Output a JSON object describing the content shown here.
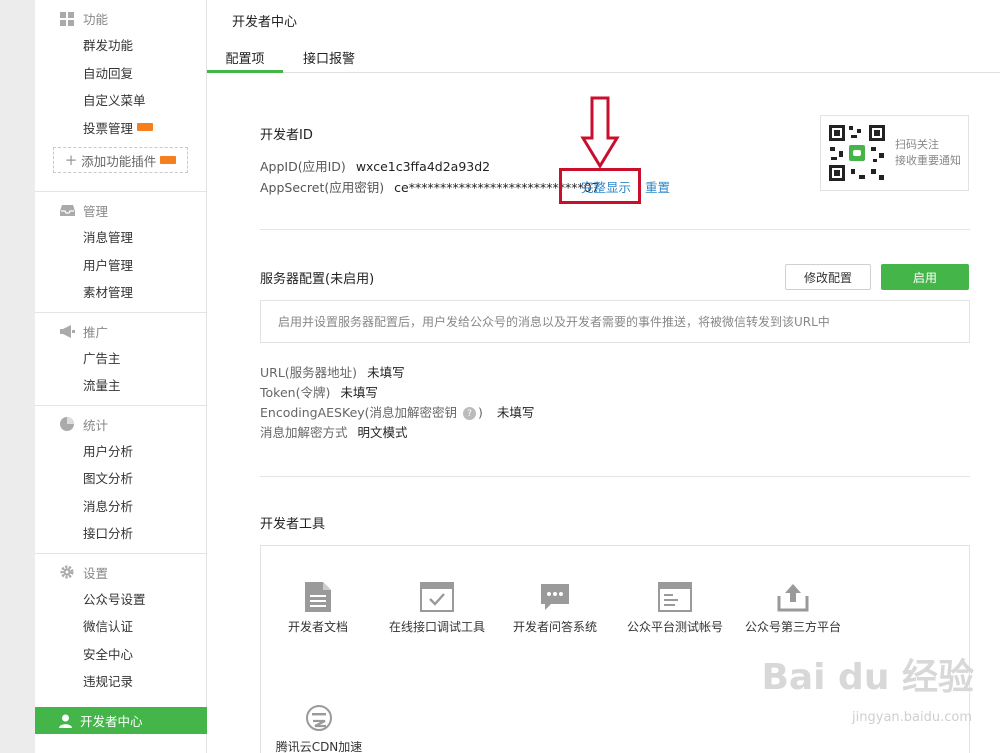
{
  "sidebar": {
    "sections": [
      {
        "title": "功能",
        "icon": "grid-icon",
        "items": [
          "群发功能",
          "自动回复",
          "自定义菜单",
          "投票管理"
        ],
        "add_plugin": "添加功能插件"
      },
      {
        "title": "管理",
        "icon": "inbox-icon",
        "items": [
          "消息管理",
          "用户管理",
          "素材管理"
        ]
      },
      {
        "title": "推广",
        "icon": "megaphone-icon",
        "items": [
          "广告主",
          "流量主"
        ]
      },
      {
        "title": "统计",
        "icon": "pie-chart-icon",
        "items": [
          "用户分析",
          "图文分析",
          "消息分析",
          "接口分析"
        ]
      },
      {
        "title": "设置",
        "icon": "gear-icon",
        "items": [
          "公众号设置",
          "微信认证",
          "安全中心",
          "违规记录"
        ]
      }
    ],
    "active_item": "开发者中心",
    "accent_color": "#44b549"
  },
  "page": {
    "title": "开发者中心"
  },
  "tabs": [
    {
      "label": "配置项",
      "active": true
    },
    {
      "label": "接口报警",
      "active": false
    }
  ],
  "developer_id": {
    "heading": "开发者ID",
    "appid_label": "AppID(应用ID)",
    "appid_value": "wxce1c3ffa4d2a93d2",
    "secret_label": "AppSecret(应用密钥)",
    "secret_value": "ce****************************07",
    "show_full_link": "完整显示",
    "reset_link": "重置"
  },
  "qr": {
    "line1": "扫码关注",
    "line2": "接收重要通知"
  },
  "server": {
    "heading": "服务器配置(未启用)",
    "modify_button": "修改配置",
    "enable_button": "启用",
    "notice": "启用并设置服务器配置后，用户发给公众号的消息以及开发者需要的事件推送，将被微信转发到该URL中",
    "url_label": "URL(服务器地址)",
    "url_value": "未填写",
    "token_label": "Token(令牌)",
    "token_value": "未填写",
    "aes_label": "EncodingAESKey(消息加解密密钥",
    "aes_label_end": ")",
    "aes_value": "未填写",
    "mode_label": "消息加解密方式",
    "mode_value": "明文模式"
  },
  "tools": {
    "heading": "开发者工具",
    "items": [
      {
        "label": "开发者文档",
        "icon": "document-icon"
      },
      {
        "label": "在线接口调试工具",
        "icon": "browser-check-icon"
      },
      {
        "label": "开发者问答系统",
        "icon": "chat-bubble-icon"
      },
      {
        "label": "公众平台测试帐号",
        "icon": "browser-window-icon"
      },
      {
        "label": "公众号第三方平台",
        "icon": "upload-tray-icon"
      },
      {
        "label": "腾讯云CDN加速",
        "icon": "cloud-cdn-icon"
      }
    ]
  },
  "watermark": {
    "brand": "Bai du 经验",
    "url": "jingyan.baidu.com"
  }
}
